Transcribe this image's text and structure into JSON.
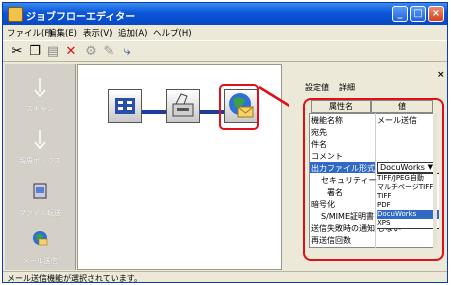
{
  "window": {
    "title": "ジョブフローエディター"
  },
  "menu": [
    "ファイル(F)",
    "編集(E)",
    "表示(V)",
    "追加(A)",
    "ヘルプ(H)"
  ],
  "sidebar": {
    "items": [
      {
        "label": "スキャン",
        "icon": "scan-icon"
      },
      {
        "label": "親展ボックス",
        "icon": "mailbox-icon"
      },
      {
        "label": "ファイル転送",
        "icon": "file-transfer-icon"
      },
      {
        "label": "メール送信",
        "icon": "mail-send-icon"
      }
    ]
  },
  "panel": {
    "tabs": [
      "設定値",
      "詳細"
    ],
    "headers": {
      "name": "属性名",
      "value": "値"
    },
    "rows": [
      {
        "name": "機能名称",
        "value": "メール送信"
      },
      {
        "name": "宛先",
        "value": ""
      },
      {
        "name": "件名",
        "value": ""
      },
      {
        "name": "コメント",
        "value": ""
      },
      {
        "name": "出力ファイル形式",
        "value": "DocuWorks"
      },
      {
        "name": "セキュリティー",
        "value": ""
      },
      {
        "name": "署名",
        "value": ""
      },
      {
        "name": "暗号化",
        "value": ""
      },
      {
        "name": "S/MIME証明書",
        "value": ""
      },
      {
        "name": "送信失敗時の通知",
        "value": "しない"
      },
      {
        "name": "再送信回数",
        "value": ""
      }
    ],
    "dropdown_options": [
      "TIFF/JPEG自動",
      "マルチページTIFF",
      "TIFF",
      "PDF",
      "DocuWorks",
      "XPS"
    ],
    "dropdown_selected": "DocuWorks"
  },
  "status": {
    "text": "メール送信機能が選択されています。"
  },
  "colors": {
    "title_bar": "#0b55d8",
    "highlight": "#e0101a",
    "selection": "#316ac5",
    "flow_line": "#1b3d9a"
  }
}
